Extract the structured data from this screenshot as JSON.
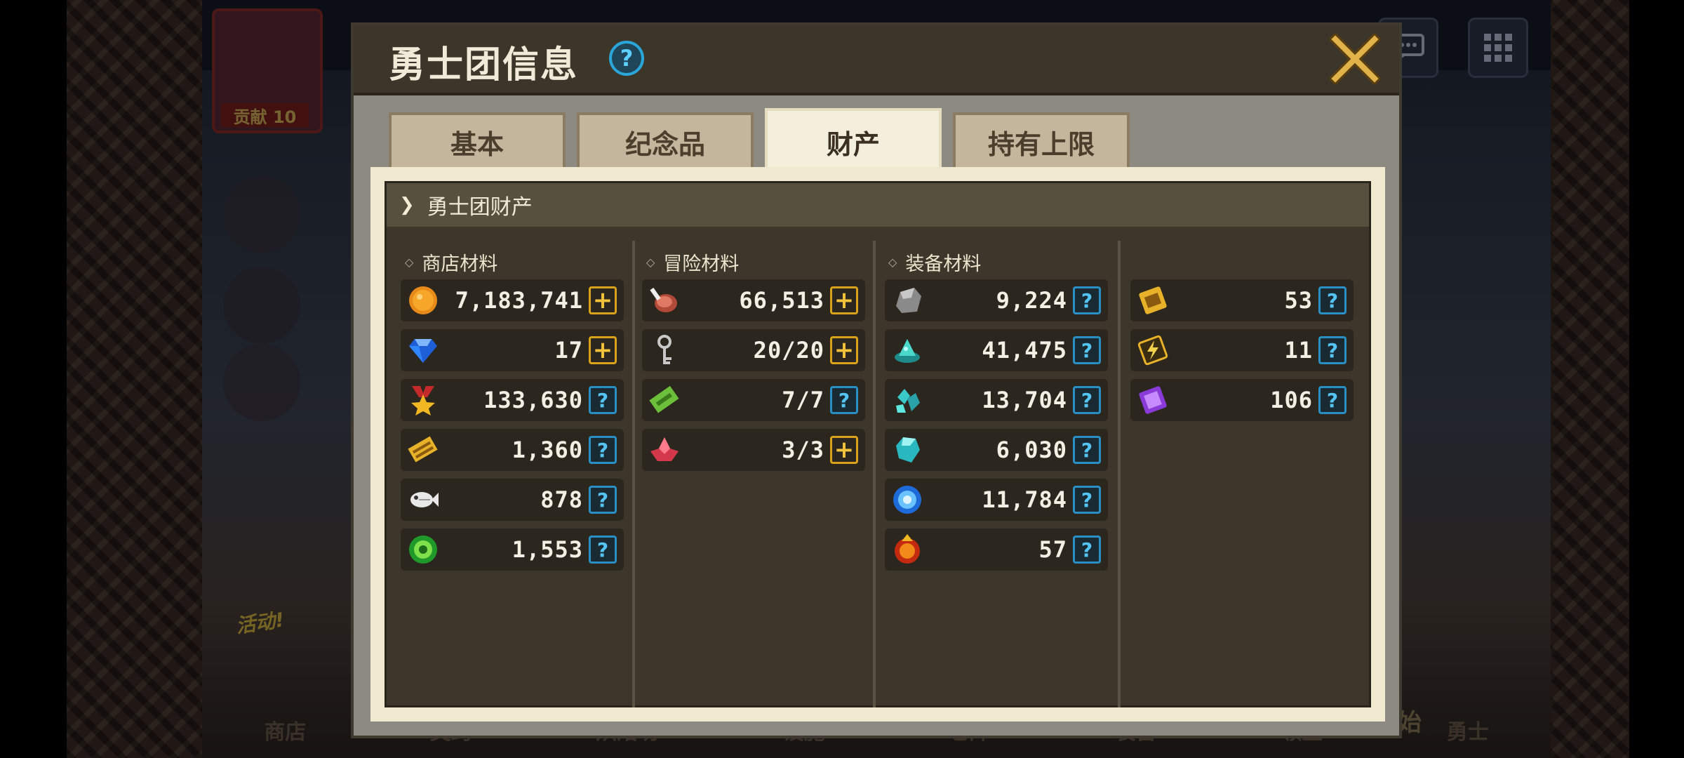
{
  "background": {
    "portrait_badge": "贡献 10",
    "event_tag": "活动!",
    "start_label": "开始",
    "nav": [
      "商店",
      "契约",
      "烘焙坊",
      "设施",
      "仓库",
      "装备",
      "领主",
      "勇士"
    ]
  },
  "dialog": {
    "title": "勇士团信息",
    "tabs": [
      "基本",
      "纪念品",
      "财产",
      "持有上限"
    ],
    "active_tab": "财产",
    "section_title": "勇士团财产",
    "columns": {
      "shop": {
        "header": "商店材料",
        "rows": [
          {
            "icon": "gold-coin-icon",
            "value": "7,183,741",
            "button": "plus"
          },
          {
            "icon": "blue-diamond-icon",
            "value": "17",
            "button": "plus"
          },
          {
            "icon": "medal-star-icon",
            "value": "133,630",
            "button": "help"
          },
          {
            "icon": "gold-ticket-icon",
            "value": "1,360",
            "button": "help"
          },
          {
            "icon": "fish-bone-icon",
            "value": "878",
            "button": "help"
          },
          {
            "icon": "green-orb-icon",
            "value": "1,553",
            "button": "help"
          }
        ]
      },
      "adventure": {
        "header": "冒险材料",
        "rows": [
          {
            "icon": "meat-icon",
            "value": "66,513",
            "button": "plus"
          },
          {
            "icon": "key-icon",
            "value": "20/20",
            "button": "plus"
          },
          {
            "icon": "green-ticket-icon",
            "value": "7/7",
            "button": "help"
          },
          {
            "icon": "red-crystal-icon",
            "value": "3/3",
            "button": "plus"
          }
        ]
      },
      "equipment": {
        "header": "装备材料",
        "rows": [
          {
            "icon": "stone-icon",
            "value": "9,224",
            "button": "help"
          },
          {
            "icon": "teal-powder-icon",
            "value": "41,475",
            "button": "help"
          },
          {
            "icon": "teal-shards-icon",
            "value": "13,704",
            "button": "help"
          },
          {
            "icon": "teal-gem-icon",
            "value": "6,030",
            "button": "help"
          },
          {
            "icon": "blue-orb-icon",
            "value": "11,784",
            "button": "help"
          },
          {
            "icon": "fire-orb-icon",
            "value": "57",
            "button": "help"
          }
        ]
      },
      "extra": {
        "rows": [
          {
            "icon": "gold-card-icon",
            "value": "53",
            "button": "help"
          },
          {
            "icon": "lightning-card-icon",
            "value": "11",
            "button": "help"
          },
          {
            "icon": "purple-card-icon",
            "value": "106",
            "button": "help"
          }
        ]
      }
    }
  },
  "colors": {
    "title_bar": "#3c3529",
    "panel": "#3d372b",
    "plus_button": "#d9a21a",
    "help_button": "#2a8fc4"
  }
}
